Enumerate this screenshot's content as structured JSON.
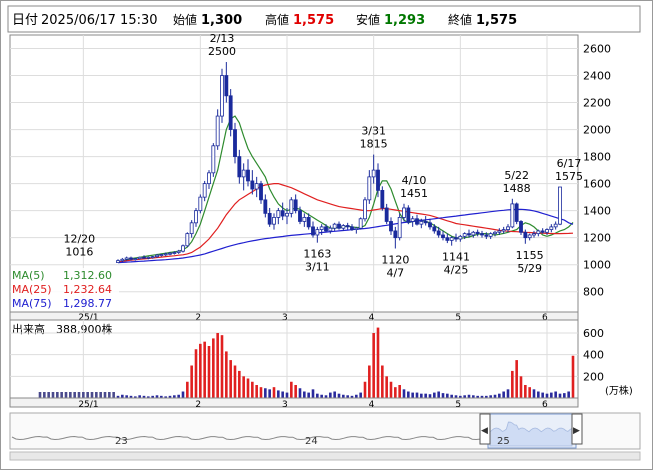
{
  "header": {
    "date_label": "日付",
    "date_value": "2025/06/17 15:30",
    "open_label": "始値",
    "open_value": "1,300",
    "high_label": "高値",
    "high_value": "1,575",
    "low_label": "安値",
    "low_value": "1,293",
    "close_label": "終値",
    "close_value": "1,575"
  },
  "colors": {
    "candle_up": "#ffffff",
    "candle_down": "#1a2a9c",
    "ma5": "#2e8b2e",
    "ma25": "#e02020",
    "ma75": "#2020d0",
    "volume_bar": "#e02020",
    "volume_bar_dark": "#2a2a9c",
    "high_text": "#e00000",
    "low_text": "#007700"
  },
  "legend": [
    {
      "label": "MA(5)",
      "value": "1,312.60",
      "color": "#2e8b2e"
    },
    {
      "label": "MA(25)",
      "value": "1,232.64",
      "color": "#e02020"
    },
    {
      "label": "MA(75)",
      "value": "1,298.77",
      "color": "#2020d0"
    }
  ],
  "volume_label": "出来高",
  "volume_value": "388,900株",
  "volume_unit": "(万株)",
  "annotations": [
    {
      "date": "12/20",
      "value": "1016"
    },
    {
      "date": "2/13",
      "value": "2500"
    },
    {
      "date": "3/11",
      "value": "1163"
    },
    {
      "date": "3/31",
      "value": "1815"
    },
    {
      "date": "4/7",
      "value": "1120"
    },
    {
      "date": "4/10",
      "value": "1451"
    },
    {
      "date": "4/25",
      "value": "1141"
    },
    {
      "date": "5/22",
      "value": "1488"
    },
    {
      "date": "5/29",
      "value": "1155"
    },
    {
      "date": "6/17",
      "value": "1575"
    }
  ],
  "navigator": {
    "labels": [
      "23",
      "24",
      "25"
    ],
    "left_arrow": "◀",
    "right_arrow": "▶"
  },
  "chart_data": {
    "type": "candlestick",
    "x_ticks": [
      "25/1",
      "2",
      "3",
      "4",
      "5",
      "6"
    ],
    "y_ticks": [
      800,
      1000,
      1200,
      1400,
      1600,
      1800,
      2000,
      2200,
      2400,
      2600
    ],
    "ylim": [
      650,
      2700
    ],
    "volume_ticks": [
      200,
      400,
      600
    ],
    "volume_ylim": [
      0,
      720
    ],
    "grid": true,
    "candles_ohlc": [
      [
        1016,
        1040,
        1016,
        1030
      ],
      [
        1030,
        1050,
        1020,
        1040
      ],
      [
        1040,
        1060,
        1030,
        1050
      ],
      [
        1050,
        1060,
        1030,
        1040
      ],
      [
        1040,
        1050,
        1030,
        1045
      ],
      [
        1045,
        1060,
        1040,
        1055
      ],
      [
        1055,
        1070,
        1045,
        1050
      ],
      [
        1050,
        1060,
        1040,
        1055
      ],
      [
        1055,
        1065,
        1045,
        1060
      ],
      [
        1060,
        1080,
        1050,
        1070
      ],
      [
        1070,
        1080,
        1060,
        1075
      ],
      [
        1075,
        1090,
        1065,
        1080
      ],
      [
        1080,
        1095,
        1070,
        1085
      ],
      [
        1085,
        1100,
        1075,
        1090
      ],
      [
        1090,
        1110,
        1080,
        1100
      ],
      [
        1100,
        1150,
        1090,
        1140
      ],
      [
        1140,
        1240,
        1130,
        1230
      ],
      [
        1230,
        1330,
        1200,
        1310
      ],
      [
        1310,
        1420,
        1280,
        1400
      ],
      [
        1400,
        1520,
        1380,
        1500
      ],
      [
        1500,
        1620,
        1470,
        1600
      ],
      [
        1600,
        1700,
        1560,
        1680
      ],
      [
        1680,
        1900,
        1650,
        1880
      ],
      [
        1880,
        2150,
        1850,
        2100
      ],
      [
        2100,
        2450,
        2050,
        2400
      ],
      [
        2400,
        2500,
        2200,
        2250
      ],
      [
        2250,
        2300,
        1950,
        2000
      ],
      [
        2000,
        2050,
        1750,
        1800
      ],
      [
        1800,
        1850,
        1600,
        1650
      ],
      [
        1650,
        1750,
        1550,
        1700
      ],
      [
        1700,
        1780,
        1580,
        1620
      ],
      [
        1620,
        1700,
        1520,
        1560
      ],
      [
        1560,
        1650,
        1500,
        1600
      ],
      [
        1600,
        1620,
        1450,
        1480
      ],
      [
        1480,
        1520,
        1350,
        1380
      ],
      [
        1380,
        1420,
        1280,
        1300
      ],
      [
        1300,
        1380,
        1260,
        1350
      ],
      [
        1350,
        1420,
        1300,
        1400
      ],
      [
        1400,
        1460,
        1330,
        1360
      ],
      [
        1360,
        1420,
        1300,
        1380
      ],
      [
        1380,
        1500,
        1350,
        1480
      ],
      [
        1480,
        1520,
        1380,
        1400
      ],
      [
        1400,
        1430,
        1300,
        1320
      ],
      [
        1320,
        1380,
        1280,
        1350
      ],
      [
        1350,
        1380,
        1260,
        1280
      ],
      [
        1280,
        1320,
        1200,
        1220
      ],
      [
        1220,
        1280,
        1163,
        1260
      ],
      [
        1260,
        1300,
        1220,
        1280
      ],
      [
        1280,
        1300,
        1240,
        1250
      ],
      [
        1250,
        1290,
        1230,
        1270
      ],
      [
        1270,
        1310,
        1250,
        1300
      ],
      [
        1300,
        1320,
        1260,
        1270
      ],
      [
        1270,
        1300,
        1250,
        1290
      ],
      [
        1290,
        1310,
        1260,
        1280
      ],
      [
        1280,
        1300,
        1250,
        1260
      ],
      [
        1260,
        1280,
        1230,
        1270
      ],
      [
        1270,
        1350,
        1260,
        1340
      ],
      [
        1340,
        1500,
        1320,
        1480
      ],
      [
        1480,
        1700,
        1450,
        1650
      ],
      [
        1650,
        1815,
        1600,
        1700
      ],
      [
        1700,
        1750,
        1500,
        1550
      ],
      [
        1550,
        1580,
        1400,
        1420
      ],
      [
        1420,
        1450,
        1300,
        1320
      ],
      [
        1320,
        1350,
        1220,
        1250
      ],
      [
        1250,
        1280,
        1120,
        1200
      ],
      [
        1200,
        1380,
        1180,
        1350
      ],
      [
        1350,
        1451,
        1320,
        1420
      ],
      [
        1420,
        1440,
        1300,
        1320
      ],
      [
        1320,
        1360,
        1280,
        1340
      ],
      [
        1340,
        1370,
        1290,
        1300
      ],
      [
        1300,
        1340,
        1270,
        1320
      ],
      [
        1320,
        1360,
        1290,
        1310
      ],
      [
        1310,
        1340,
        1260,
        1280
      ],
      [
        1280,
        1300,
        1230,
        1250
      ],
      [
        1250,
        1280,
        1200,
        1220
      ],
      [
        1220,
        1250,
        1180,
        1200
      ],
      [
        1200,
        1230,
        1160,
        1180
      ],
      [
        1180,
        1210,
        1141,
        1200
      ],
      [
        1200,
        1230,
        1170,
        1190
      ],
      [
        1190,
        1220,
        1170,
        1210
      ],
      [
        1210,
        1240,
        1190,
        1230
      ],
      [
        1230,
        1260,
        1200,
        1220
      ],
      [
        1220,
        1250,
        1200,
        1240
      ],
      [
        1240,
        1260,
        1210,
        1230
      ],
      [
        1230,
        1250,
        1200,
        1220
      ],
      [
        1220,
        1240,
        1190,
        1210
      ],
      [
        1210,
        1240,
        1190,
        1230
      ],
      [
        1230,
        1250,
        1210,
        1240
      ],
      [
        1240,
        1270,
        1220,
        1250
      ],
      [
        1250,
        1280,
        1230,
        1260
      ],
      [
        1260,
        1300,
        1240,
        1280
      ],
      [
        1280,
        1488,
        1270,
        1450
      ],
      [
        1450,
        1460,
        1300,
        1320
      ],
      [
        1320,
        1330,
        1220,
        1240
      ],
      [
        1240,
        1260,
        1155,
        1200
      ],
      [
        1200,
        1230,
        1180,
        1220
      ],
      [
        1220,
        1250,
        1200,
        1230
      ],
      [
        1230,
        1260,
        1210,
        1250
      ],
      [
        1250,
        1270,
        1230,
        1240
      ],
      [
        1240,
        1270,
        1220,
        1260
      ],
      [
        1260,
        1300,
        1240,
        1280
      ],
      [
        1280,
        1320,
        1260,
        1300
      ],
      [
        1300,
        1575,
        1293,
        1575
      ]
    ],
    "series": [
      {
        "name": "MA(5)",
        "values": [
          1016,
          1025,
          1035,
          1045,
          1050,
          1055,
          1060,
          1065,
          1070,
          1075,
          1080,
          1085,
          1090,
          1095,
          1100,
          1110,
          1130,
          1170,
          1230,
          1300,
          1400,
          1500,
          1600,
          1700,
          1850,
          2000,
          2080,
          2100,
          2050,
          1950,
          1860,
          1800,
          1750,
          1700,
          1650,
          1560,
          1500,
          1450,
          1420,
          1400,
          1410,
          1420,
          1410,
          1390,
          1370,
          1350,
          1330,
          1310,
          1290,
          1270,
          1270,
          1275,
          1280,
          1285,
          1280,
          1275,
          1275,
          1290,
          1350,
          1450,
          1560,
          1620,
          1620,
          1560,
          1470,
          1380,
          1330,
          1310,
          1320,
          1330,
          1330,
          1320,
          1310,
          1290,
          1270,
          1250,
          1230,
          1210,
          1200,
          1195,
          1200,
          1205,
          1215,
          1225,
          1230,
          1230,
          1225,
          1220,
          1225,
          1232,
          1240,
          1250,
          1260,
          1290,
          1310,
          1300,
          1280,
          1250,
          1220,
          1210,
          1220,
          1235,
          1250,
          1260,
          1280,
          1313
        ]
      },
      {
        "name": "MA(25)",
        "values": [
          1020,
          1025,
          1030,
          1033,
          1036,
          1040,
          1043,
          1046,
          1050,
          1053,
          1056,
          1060,
          1063,
          1066,
          1070,
          1073,
          1080,
          1090,
          1110,
          1130,
          1160,
          1190,
          1230,
          1270,
          1320,
          1370,
          1410,
          1450,
          1480,
          1500,
          1520,
          1540,
          1560,
          1580,
          1590,
          1595,
          1600,
          1600,
          1590,
          1580,
          1570,
          1555,
          1540,
          1525,
          1510,
          1495,
          1480,
          1470,
          1460,
          1450,
          1440,
          1430,
          1425,
          1420,
          1415,
          1410,
          1405,
          1400,
          1400,
          1405,
          1410,
          1415,
          1415,
          1410,
          1405,
          1400,
          1395,
          1390,
          1385,
          1380,
          1375,
          1370,
          1365,
          1355,
          1345,
          1335,
          1325,
          1315,
          1305,
          1300,
          1295,
          1290,
          1285,
          1280,
          1275,
          1270,
          1265,
          1260,
          1255,
          1250,
          1248,
          1246,
          1244,
          1242,
          1240,
          1238,
          1236,
          1234,
          1233,
          1232,
          1231,
          1230,
          1230,
          1231,
          1232,
          1233
        ]
      },
      {
        "name": "MA(75)",
        "values": [
          1015,
          1017,
          1019,
          1021,
          1023,
          1025,
          1027,
          1029,
          1031,
          1033,
          1035,
          1037,
          1040,
          1043,
          1046,
          1050,
          1055,
          1060,
          1066,
          1072,
          1080,
          1090,
          1100,
          1110,
          1120,
          1130,
          1140,
          1148,
          1156,
          1163,
          1170,
          1176,
          1182,
          1188,
          1193,
          1197,
          1201,
          1205,
          1209,
          1213,
          1217,
          1220,
          1223,
          1226,
          1229,
          1232,
          1235,
          1238,
          1241,
          1244,
          1247,
          1250,
          1253,
          1256,
          1259,
          1262,
          1265,
          1268,
          1272,
          1277,
          1282,
          1287,
          1292,
          1297,
          1302,
          1307,
          1312,
          1316,
          1320,
          1324,
          1328,
          1332,
          1336,
          1340,
          1344,
          1348,
          1352,
          1356,
          1360,
          1364,
          1368,
          1372,
          1376,
          1380,
          1384,
          1388,
          1392,
          1396,
          1400,
          1403,
          1406,
          1408,
          1409,
          1410,
          1408,
          1404,
          1398,
          1390,
          1380,
          1370,
          1360,
          1350,
          1340,
          1330,
          1310,
          1299
        ]
      }
    ],
    "volume_values": [
      20,
      30,
      25,
      20,
      15,
      25,
      20,
      15,
      20,
      25,
      20,
      15,
      20,
      25,
      30,
      60,
      150,
      300,
      450,
      500,
      520,
      480,
      550,
      600,
      580,
      430,
      350,
      300,
      250,
      200,
      180,
      150,
      120,
      100,
      90,
      80,
      100,
      70,
      60,
      50,
      150,
      120,
      90,
      60,
      50,
      80,
      40,
      30,
      25,
      50,
      60,
      40,
      30,
      25,
      20,
      30,
      50,
      150,
      300,
      600,
      650,
      300,
      200,
      150,
      100,
      120,
      80,
      60,
      50,
      50,
      40,
      40,
      35,
      50,
      60,
      45,
      40,
      30,
      25,
      20,
      25,
      30,
      25,
      20,
      20,
      20,
      25,
      30,
      40,
      60,
      80,
      250,
      350,
      200,
      120,
      100,
      80,
      60,
      50,
      40,
      50,
      60,
      40,
      45,
      60,
      390
    ]
  }
}
